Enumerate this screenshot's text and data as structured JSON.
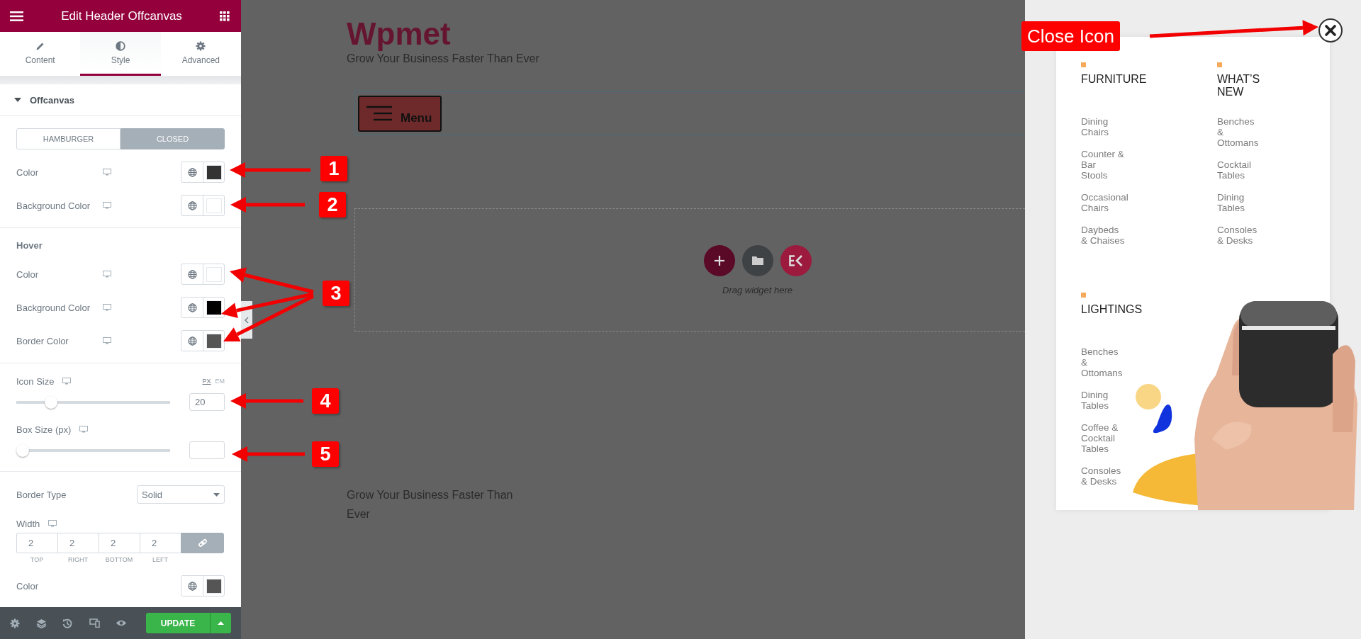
{
  "panel": {
    "title": "Edit Header Offcanvas",
    "tabs": [
      {
        "label": "Content",
        "selected": false
      },
      {
        "label": "Style",
        "selected": true
      },
      {
        "label": "Advanced",
        "selected": false
      }
    ],
    "section": {
      "title": "Offcanvas",
      "expanded": true
    },
    "groups": [
      {
        "rows": [
          {
            "kind": "toggle",
            "options": [
              {
                "label": "HAMBURGER",
                "selected": false
              },
              {
                "label": "CLOSED",
                "selected": true
              }
            ]
          },
          {
            "kind": "color",
            "label": "Color",
            "responsive": true,
            "color": "#333333"
          },
          {
            "kind": "color",
            "label": "Background Color",
            "responsive": true,
            "color": "#ffffff"
          }
        ]
      },
      {
        "rows": [
          {
            "kind": "heading",
            "label": "Hover"
          },
          {
            "kind": "color",
            "label": "Color",
            "responsive": true,
            "color": "#ffffff"
          },
          {
            "kind": "color",
            "label": "Background Color",
            "responsive": true,
            "color": "#000000"
          },
          {
            "kind": "color",
            "label": "Border Color",
            "responsive": true,
            "color": "#555555"
          }
        ]
      },
      {
        "rows": [
          {
            "kind": "slider",
            "label": "Icon Size",
            "responsive": true,
            "units": [
              {
                "label": "PX",
                "selected": true
              },
              {
                "label": "EM",
                "selected": false
              }
            ],
            "level": 0.2,
            "value": "20"
          },
          {
            "kind": "slider",
            "label": "Box Size (px)",
            "responsive": true,
            "level": 0
          }
        ]
      },
      {
        "rows": [
          {
            "kind": "select",
            "label": "Border Type",
            "value": "Solid"
          },
          {
            "kind": "dimensions",
            "label": "Width",
            "responsive": true,
            "linked": true,
            "fields": [
              {
                "value": "2",
                "label": "TOP"
              },
              {
                "value": "2",
                "label": "RIGHT"
              },
              {
                "value": "2",
                "label": "BOTTOM"
              },
              {
                "value": "2",
                "label": "LEFT"
              }
            ]
          },
          {
            "kind": "color",
            "label": "Color",
            "responsive": false,
            "color": "#555555"
          }
        ]
      }
    ],
    "update": "UPDATE"
  },
  "canvas": {
    "site_title": "Wpmet",
    "tagline": "Grow Your Business Faster Than Ever",
    "menu_button": "Menu",
    "drop_hint": "Drag widget here",
    "footer_text": "Grow Your Business Faster Than Ever"
  },
  "offcanvas": {
    "columns": [
      {
        "heading": "FURNITURE",
        "items": [
          "Dining Chairs",
          "Counter & Bar Stools",
          "Occasional Chairs",
          "Daybeds & Chaises"
        ]
      },
      {
        "heading": "WHAT’S NEW",
        "items": [
          "Benches & Ottomans",
          "Cocktail Tables",
          "Dining Tables",
          "Consoles & Desks"
        ]
      },
      {
        "heading": "LIGHTINGS",
        "items": [
          "Benches & Ottomans",
          "Dining Tables",
          "Coffee & Cocktail Tables",
          "Consoles & Desks"
        ]
      }
    ]
  },
  "annotations": {
    "numbers": [
      "1",
      "2",
      "3",
      "4",
      "5"
    ],
    "close_label": "Close Icon"
  }
}
